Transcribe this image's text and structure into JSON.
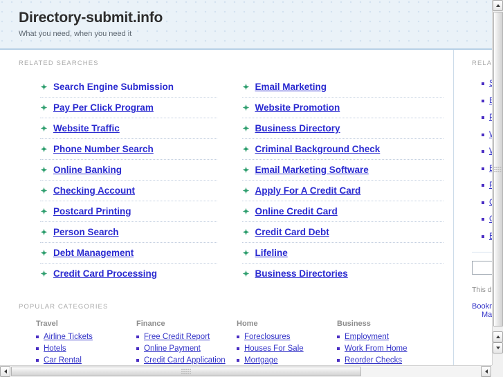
{
  "header": {
    "title": "Directory-submit.info",
    "tagline": "What you need, when you need it"
  },
  "main": {
    "related_searches_label": "RELATED SEARCHES",
    "related_searches": {
      "left": [
        "Search Engine Submission",
        "Pay Per Click Program",
        "Website Traffic",
        "Phone Number Search",
        "Online Banking",
        "Checking Account",
        "Postcard Printing",
        "Person Search",
        "Debt Management",
        "Credit Card Processing"
      ],
      "right": [
        "Email Marketing",
        "Website Promotion",
        "Business Directory",
        "Criminal Background Check",
        "Email Marketing Software",
        "Apply For A Credit Card",
        "Online Credit Card",
        "Credit Card Debt",
        "Lifeline",
        "Business Directories"
      ]
    },
    "popular_categories_label": "POPULAR CATEGORIES",
    "categories": [
      {
        "title": "Travel",
        "links": [
          "Airline Tickets",
          "Hotels",
          "Car Rental"
        ]
      },
      {
        "title": "Finance",
        "links": [
          "Free Credit Report",
          "Online Payment",
          "Credit Card Application"
        ]
      },
      {
        "title": "Home",
        "links": [
          "Foreclosures",
          "Houses For Sale",
          "Mortgage"
        ]
      },
      {
        "title": "Business",
        "links": [
          "Employment",
          "Work From Home",
          "Reorder Checks"
        ]
      }
    ]
  },
  "sidebar": {
    "label": "RELATED SEARCHES",
    "links": [
      "Search Engine Submission",
      "Email Marketing",
      "Pay Per Click Program",
      "Website Promotion",
      "Website Traffic",
      "Business Directory",
      "Phone Number Search",
      "Criminal Background Check",
      "Online Banking",
      "Email Marketing Software"
    ],
    "search_value": "",
    "search_placeholder": "",
    "note": "This domain may be for sale",
    "actions": [
      "Bookmark this page",
      "Make this my homepage"
    ]
  },
  "colors": {
    "link": "#3434c8",
    "related_link": "#2a2ad0",
    "arrow_bullet": "#2e9e6e",
    "square_bullet": "#4b2fc4",
    "header_bg": "#eaf2f8",
    "header_border": "#b6cfe6"
  },
  "scrollbars": {
    "vertical_arrow_up": "scroll-up-icon",
    "vertical_arrow_down": "scroll-down-icon",
    "horizontal_arrow_left": "scroll-left-icon",
    "horizontal_arrow_right": "scroll-right-icon"
  }
}
